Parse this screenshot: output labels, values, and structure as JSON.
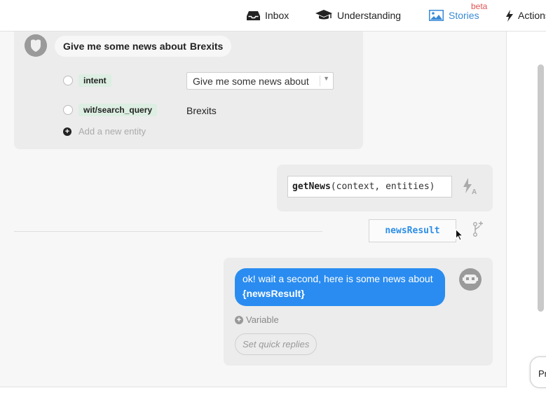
{
  "nav": {
    "inbox": "Inbox",
    "understanding": "Understanding",
    "stories": "Stories",
    "stories_badge": "beta",
    "actions": "Actions"
  },
  "user_message": {
    "text_plain": "Give me some news about",
    "text_entity": "Brexits",
    "entities": [
      {
        "name": "intent",
        "value": "Give me some news about"
      },
      {
        "name": "wit/search_query",
        "value": "Brexits"
      }
    ],
    "add_entity": "Add a new entity"
  },
  "action": {
    "function_name": "getNews",
    "function_args": "(context, entities)"
  },
  "branch": {
    "result_variable": "newsResult"
  },
  "bot_message": {
    "text_before": "ok! wait a second, here is some news about ",
    "variable_ref": "{newsResult}",
    "variable_button": "Variable",
    "quick_replies": "Set quick replies"
  },
  "corner_button": {
    "label": "Pr"
  },
  "colors": {
    "accent": "#2a8cf0",
    "stories_active": "#3a8ad6",
    "beta": "#e05555",
    "entity_tag": "#ddeee2"
  },
  "icons": {
    "inbox": "inbox-icon",
    "understanding": "graduation-cap-icon",
    "stories": "image-icon",
    "actions": "lightning-icon"
  }
}
